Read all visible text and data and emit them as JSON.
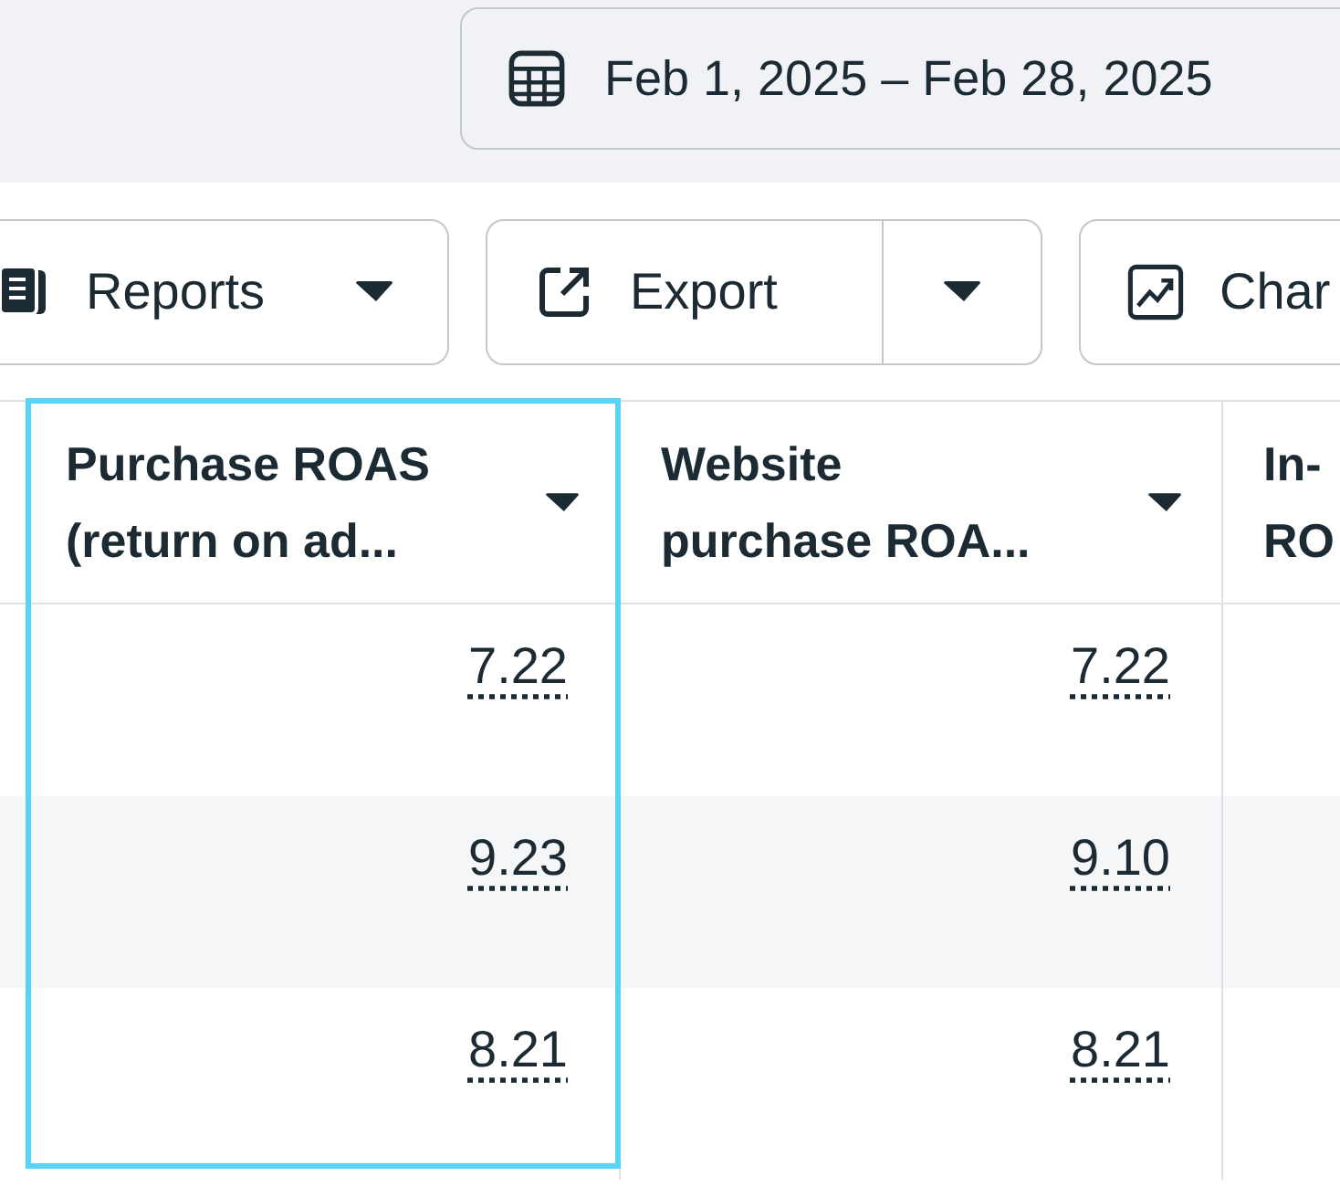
{
  "date_range": {
    "label": "Feb 1, 2025 – Feb 28, 2025"
  },
  "toolbar": [
    {
      "kind": "dropdown",
      "label": "Reports"
    },
    {
      "kind": "split",
      "label": "Export"
    },
    {
      "kind": "plain",
      "label": "Char"
    }
  ],
  "table": {
    "columns": [
      {
        "label_lines": [
          "Purchase ROAS",
          "(return on ad..."
        ],
        "highlighted": true
      },
      {
        "label_lines": [
          "Website",
          "purchase ROA..."
        ],
        "highlighted": false
      },
      {
        "label_lines": [
          "In-",
          "RO"
        ],
        "highlighted": false
      }
    ],
    "rows": [
      {
        "cells": [
          "7.22",
          "7.22"
        ]
      },
      {
        "cells": [
          "9.23",
          "9.10"
        ]
      },
      {
        "cells": [
          "8.21",
          "8.21"
        ]
      }
    ]
  }
}
